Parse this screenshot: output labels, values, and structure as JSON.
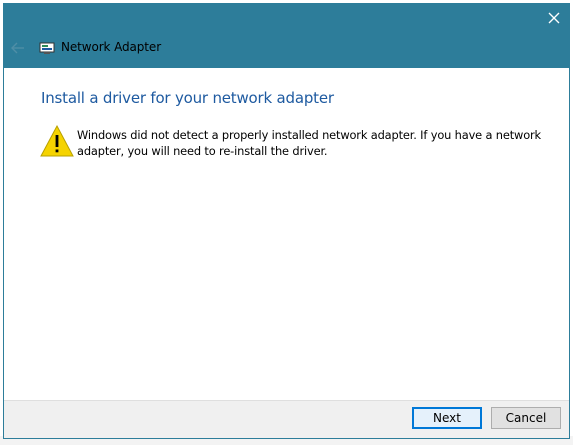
{
  "window": {
    "title": "Network Adapter",
    "accent_color": "#2d7d9a"
  },
  "icons": {
    "close": "close-icon",
    "back": "back-arrow-icon",
    "app": "network-adapter-icon",
    "warning": "warning-icon"
  },
  "content": {
    "heading": "Install a driver for your network adapter",
    "heading_color": "#1e5aa0",
    "message": "Windows did not detect a properly installed network adapter. If you have a network adapter, you will need to re-install the driver."
  },
  "buttons": {
    "next": "Next",
    "cancel": "Cancel"
  }
}
